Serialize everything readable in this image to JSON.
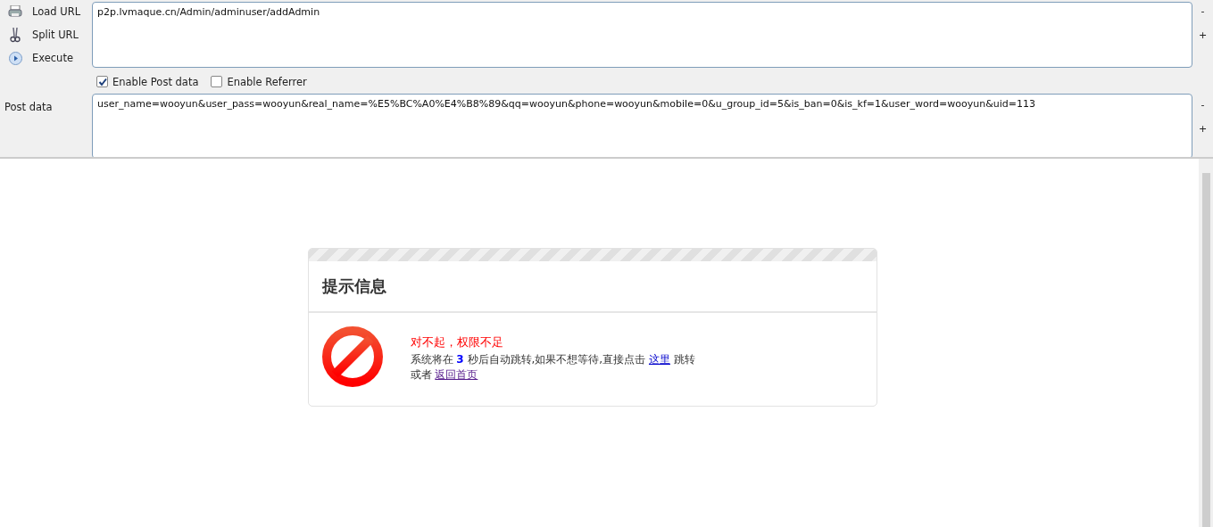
{
  "toolbar": {
    "actions": [
      {
        "kind": "load",
        "label": "Load URL"
      },
      {
        "kind": "split",
        "label": "Split URL"
      },
      {
        "kind": "execute",
        "label": "Execute"
      }
    ],
    "url_field": {
      "value": "p2p.lvmaque.cn/Admin/adminuser/addAdmin"
    },
    "url_resize": [
      "-",
      "+"
    ],
    "options": [
      {
        "label": "Enable Post data",
        "checked": true
      },
      {
        "label": "Enable Referrer",
        "checked": false
      }
    ],
    "post_label": "Post data",
    "post_field": {
      "value": "user_name=wooyun&user_pass=wooyun&real_name=%E5%BC%A0%E4%B8%89&qq=wooyun&phone=wooyun&mobile=0&u_group_id=5&is_ban=0&is_kf=1&user_word=wooyun&uid=113"
    },
    "post_resize": [
      "-",
      "+"
    ]
  },
  "notice": {
    "title": "提示信息",
    "error": "对不起，权限不足",
    "message": {
      "before": "系统将在 **3** 秒后自动跳转,如果不想等待,直接点击 ",
      "link": "这里",
      "after": " 跳转"
    },
    "second_line": {
      "before": "或者 ",
      "link": "返回首页"
    }
  }
}
